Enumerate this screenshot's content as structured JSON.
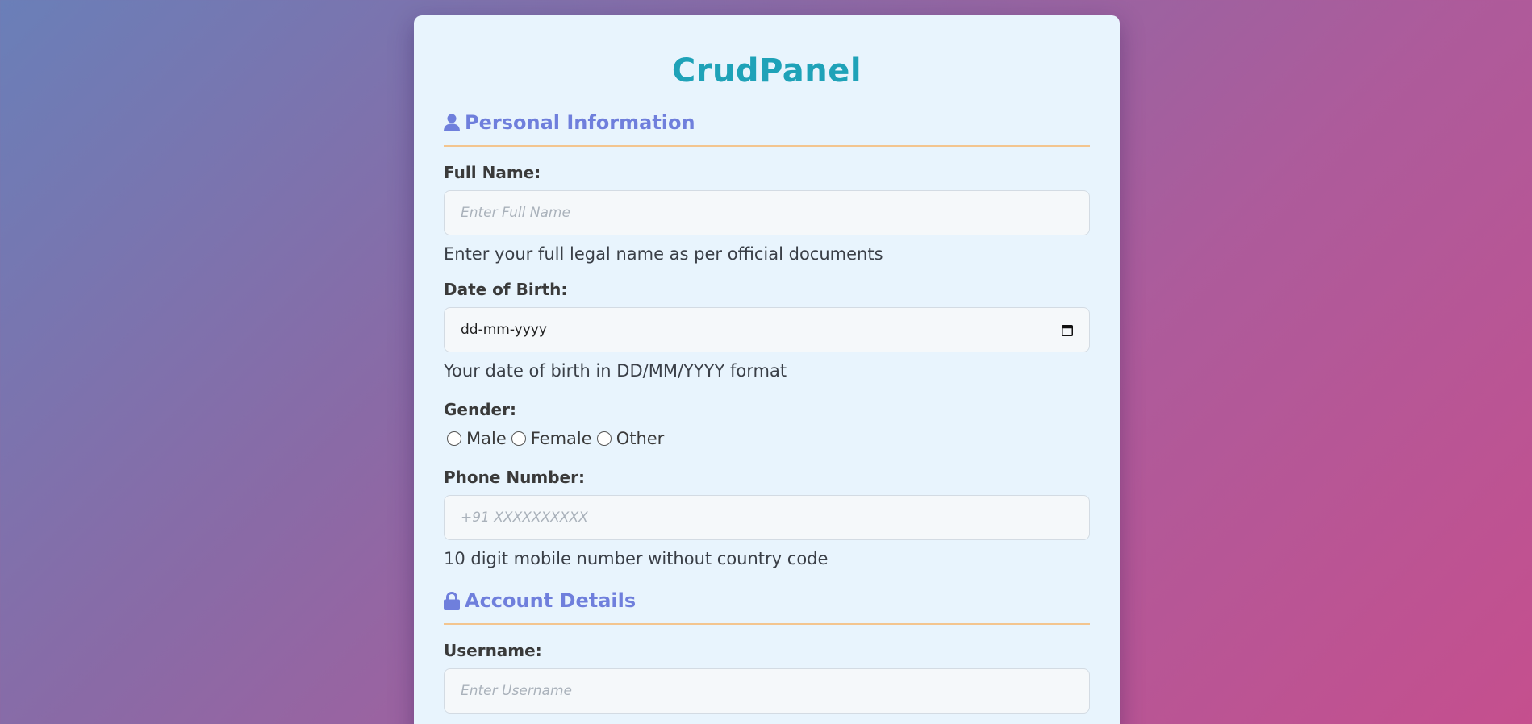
{
  "app": {
    "title": "CrudPanel"
  },
  "sections": {
    "personal": {
      "title": "Personal Information",
      "icon": "user-icon"
    },
    "account": {
      "title": "Account Details",
      "icon": "lock-icon"
    }
  },
  "fields": {
    "full_name": {
      "label": "Full Name:",
      "placeholder": "Enter Full Name",
      "help": "Enter your full legal name as per official documents"
    },
    "dob": {
      "label": "Date of Birth:",
      "value": "dd-mm-yyyy",
      "help": "Your date of birth in DD/MM/YYYY format",
      "icon": "calendar-icon"
    },
    "gender": {
      "label": "Gender:",
      "options": [
        "Male",
        "Female",
        "Other"
      ]
    },
    "phone": {
      "label": "Phone Number:",
      "placeholder": "+91 XXXXXXXXXX",
      "help": "10 digit mobile number without country code"
    },
    "username": {
      "label": "Username:",
      "placeholder": "Enter Username"
    }
  },
  "colors": {
    "title": "#1fa2b8",
    "section": "#6f7fdc",
    "divider": "#f3c58f",
    "card": "#e8f4fd"
  }
}
